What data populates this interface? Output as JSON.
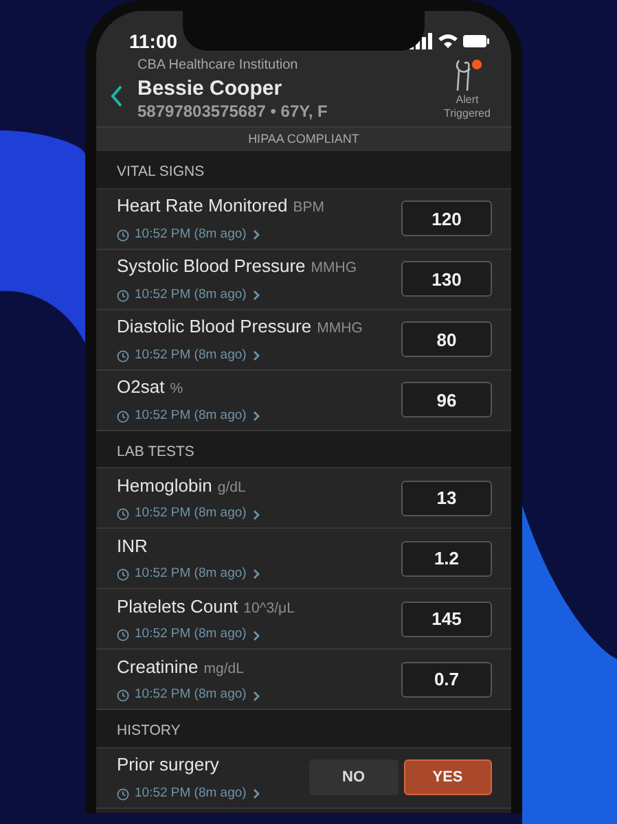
{
  "status_bar": {
    "time": "11:00"
  },
  "header": {
    "institution": "CBA Healthcare Institution",
    "patient_name": "Bessie Cooper",
    "patient_info": "58797803575687 • 67Y, F",
    "alert_label": "Alert Triggered"
  },
  "banner": "HIPAA COMPLIANT",
  "sections": [
    {
      "title": "VITAL SIGNS",
      "items": [
        {
          "kind": "number",
          "label": "Heart Rate Monitored",
          "unit": "BPM",
          "time": "10:52 PM (8m ago)",
          "value": "120"
        },
        {
          "kind": "number",
          "label": "Systolic Blood Pressure",
          "unit": "MMHG",
          "time": "10:52 PM (8m ago)",
          "value": "130"
        },
        {
          "kind": "number",
          "label": "Diastolic Blood Pressure",
          "unit": "MMHG",
          "time": "10:52 PM (8m ago)",
          "value": "80"
        },
        {
          "kind": "number",
          "label": "O2sat",
          "unit": "%",
          "time": "10:52 PM (8m ago)",
          "value": "96"
        }
      ]
    },
    {
      "title": "LAB TESTS",
      "items": [
        {
          "kind": "number",
          "label": "Hemoglobin",
          "unit": "g/dL",
          "time": "10:52 PM (8m ago)",
          "value": "13"
        },
        {
          "kind": "number",
          "label": "INR",
          "time": "10:52 PM (8m ago)",
          "value": "1.2"
        },
        {
          "kind": "number",
          "label": "Platelets Count",
          "unit": "10^3/μL",
          "time": "10:52 PM (8m ago)",
          "value": "145"
        },
        {
          "kind": "number",
          "label": "Creatinine",
          "unit": "mg/dL",
          "time": "10:52 PM (8m ago)",
          "value": "0.7"
        }
      ]
    },
    {
      "title": "HISTORY",
      "items": [
        {
          "kind": "toggle",
          "label": "Prior surgery",
          "time": "10:52 PM (8m ago)",
          "options": [
            {
              "label": "NO",
              "selected": false
            },
            {
              "label": "YES",
              "selected": true
            }
          ]
        }
      ]
    }
  ]
}
